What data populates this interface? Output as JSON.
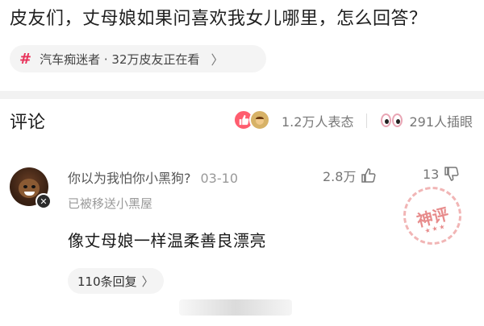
{
  "question": {
    "title": "皮友们，丈母娘如果问喜欢我女儿哪里，怎么回答？"
  },
  "topic": {
    "hash": "#",
    "text": "汽车痴迷者 · 32万皮友正在看",
    "chevron": "〉"
  },
  "comments_header": {
    "title": "评论",
    "reactions_label": "1.2万人表态",
    "views_label": "291人插眼"
  },
  "comment": {
    "meta": "你以为我怕你小黑狗?",
    "date": "03-10",
    "likes": "2.8万",
    "dislikes": "13",
    "status": "已被移送小黑屋",
    "body": "像丈母娘一样温柔善良漂亮",
    "replies": "110条回复",
    "replies_chevron": "〉",
    "stamp_text": "神评",
    "stamp_stars": "★★★"
  },
  "colors": {
    "accent": "#e8325a",
    "stamp": "#e67878"
  }
}
